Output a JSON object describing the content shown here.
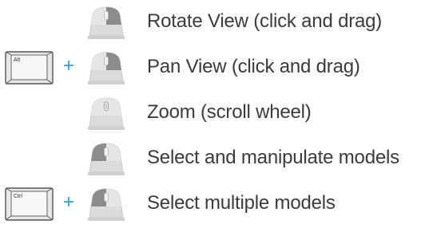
{
  "controls": [
    {
      "modifier": null,
      "mouse_button": "left",
      "action": "Rotate View (click and drag)"
    },
    {
      "modifier": "Alt",
      "plus": "+",
      "mouse_button": "left",
      "action": "Pan View (click and drag)"
    },
    {
      "modifier": null,
      "mouse_button": "wheel",
      "action": "Zoom (scroll wheel)"
    },
    {
      "modifier": null,
      "mouse_button": "left",
      "action": "Select and manipulate models"
    },
    {
      "modifier": "Ctrl",
      "plus": "+",
      "mouse_button": "left",
      "action": "Select multiple models"
    }
  ],
  "colors": {
    "plus": "#1fa3e0",
    "mouse_body": "#d9d9d9",
    "mouse_pressed": "#8a8a8a",
    "text": "#3b3b3b"
  },
  "icons": {
    "key": "keyboard-key-icon",
    "mouse": "mouse-icon"
  }
}
